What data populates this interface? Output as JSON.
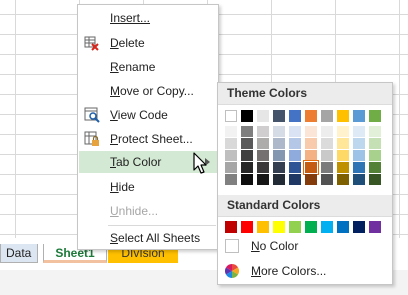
{
  "sheet_tabs": [
    {
      "label": "Data"
    },
    {
      "label": "Sheet1"
    },
    {
      "label": "DIvIsion"
    }
  ],
  "context_menu": {
    "items": [
      {
        "label": "Insert...",
        "icon": "none"
      },
      {
        "label": "Delete",
        "icon": "delete-sheet-icon"
      },
      {
        "label": "Rename",
        "icon": "none"
      },
      {
        "label": "Move or Copy...",
        "icon": "none"
      },
      {
        "label": "View Code",
        "icon": "view-code-icon"
      },
      {
        "label": "Protect Sheet...",
        "icon": "protect-sheet-icon"
      },
      {
        "label": "Tab Color",
        "icon": "none",
        "has_submenu": true,
        "highlighted": true
      },
      {
        "label": "Hide",
        "icon": "none"
      },
      {
        "label": "Unhide...",
        "icon": "none",
        "disabled": true
      },
      {
        "label": "Select All Sheets",
        "icon": "none"
      }
    ]
  },
  "color_panel": {
    "theme_title": "Theme Colors",
    "standard_title": "Standard Colors",
    "no_color_label": "No Color",
    "more_colors_label": "More Colors...",
    "theme_columns": [
      [
        "#ffffff",
        "#f2f2f2",
        "#d9d9d9",
        "#bfbfbf",
        "#a6a6a6",
        "#808080"
      ],
      [
        "#000000",
        "#7f7f7f",
        "#595959",
        "#404040",
        "#262626",
        "#0d0d0d"
      ],
      [
        "#e7e6e6",
        "#d0cece",
        "#aeabab",
        "#757171",
        "#3a3838",
        "#171616"
      ],
      [
        "#44546a",
        "#d6dce5",
        "#adb9ca",
        "#8497b0",
        "#333f50",
        "#222a35"
      ],
      [
        "#4472c4",
        "#dae3f3",
        "#b4c7e7",
        "#8faadc",
        "#2f5597",
        "#1f3864"
      ],
      [
        "#ed7d31",
        "#fbe5d6",
        "#f8cbad",
        "#f4b183",
        "#c55a11",
        "#843c0c"
      ],
      [
        "#a5a5a5",
        "#ededed",
        "#dbdbdb",
        "#c9c9c9",
        "#7b7b7b",
        "#525252"
      ],
      [
        "#ffc000",
        "#fff2cc",
        "#ffe699",
        "#ffd966",
        "#bf9000",
        "#7f6000"
      ],
      [
        "#5b9bd5",
        "#deebf7",
        "#bdd7ee",
        "#9dc3e6",
        "#2e75b6",
        "#1f4e79"
      ],
      [
        "#70ad47",
        "#e2f0d9",
        "#c5e0b4",
        "#a9d18e",
        "#538135",
        "#375623"
      ]
    ],
    "selected_swatch": {
      "column": 5,
      "row": 4
    },
    "standard_colors": [
      "#c00000",
      "#ff0000",
      "#ffc000",
      "#ffff00",
      "#92d050",
      "#00b050",
      "#00b0f0",
      "#0070c0",
      "#002060",
      "#7030a0"
    ]
  }
}
